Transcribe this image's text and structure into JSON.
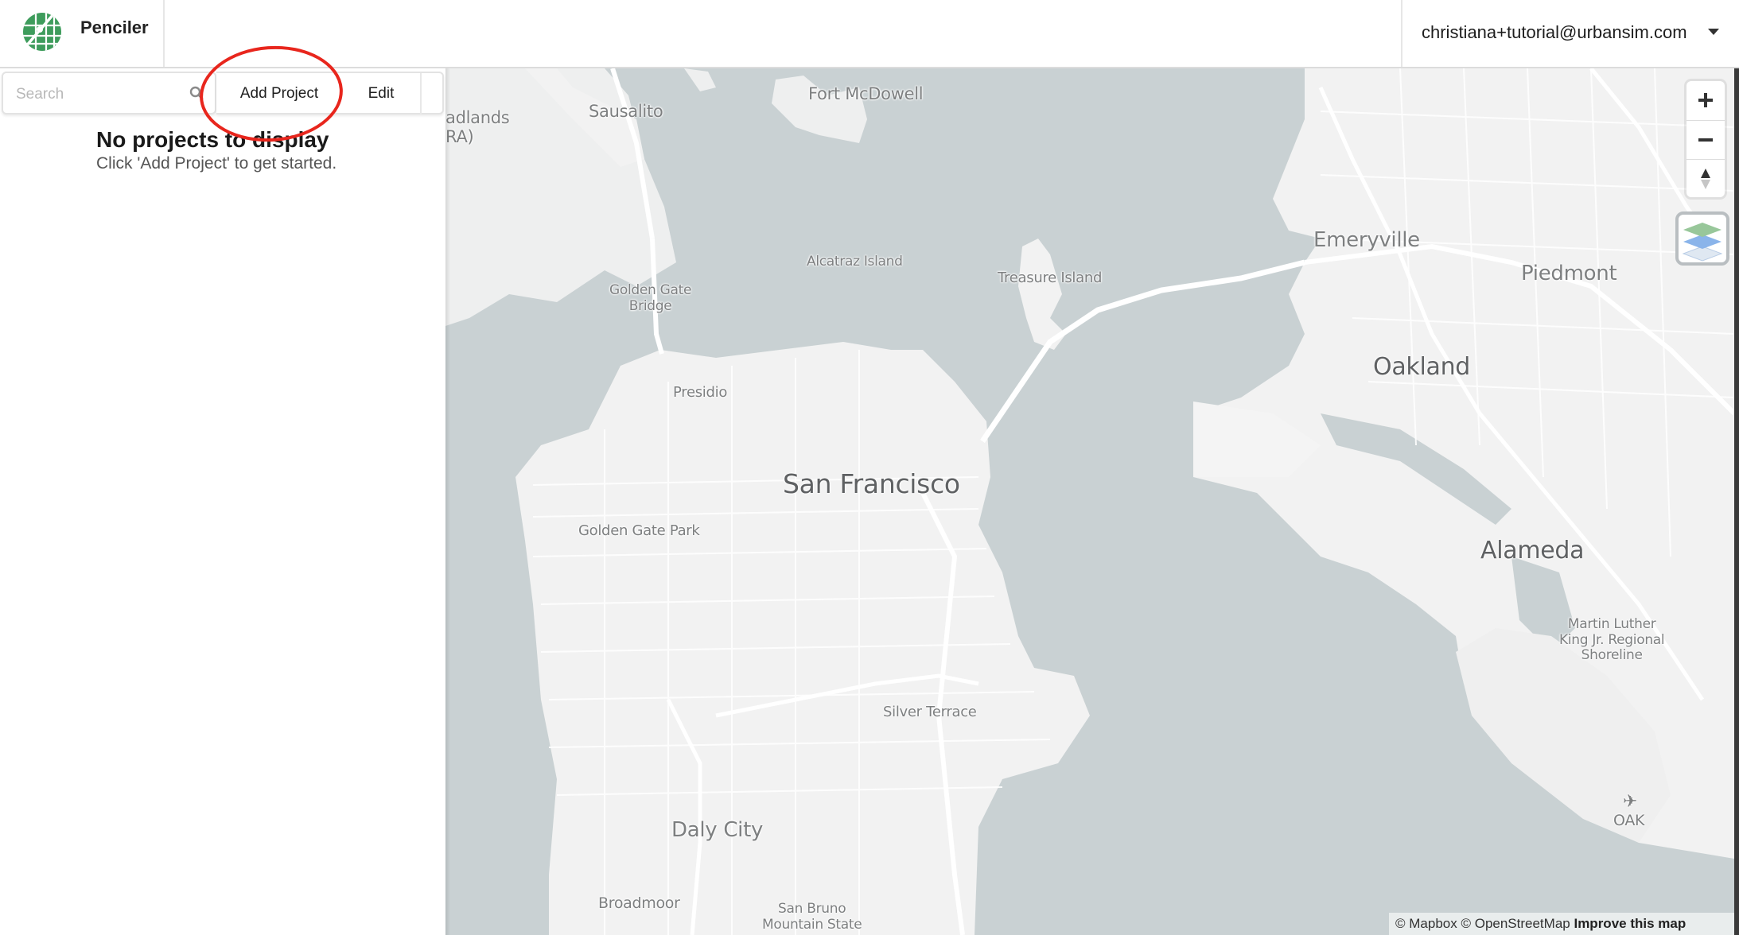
{
  "app": {
    "title": "Penciler",
    "user_email": "christiana+tutorial@urbansim.com"
  },
  "toolbar": {
    "search_placeholder": "Search",
    "search_value": "",
    "add_project_label": "Add Project",
    "edit_label": "Edit"
  },
  "empty_state": {
    "title": "No projects to display",
    "subtitle": "Click 'Add Project' to get started."
  },
  "map": {
    "labels": {
      "headlands": "adlands\nRA)",
      "sausalito": "Sausalito",
      "fort_mcdowell": "Fort McDowell",
      "alcatraz": "Alcatraz Island",
      "golden_gate_bridge": "Golden Gate\nBridge",
      "treasure_island": "Treasure Island",
      "emeryville": "Emeryville",
      "piedmont": "Piedmont",
      "oakland": "Oakland",
      "presidio": "Presidio",
      "san_francisco": "San Francisco",
      "golden_gate_park": "Golden Gate Park",
      "alameda": "Alameda",
      "mlk_shoreline": "Martin Luther\nKing Jr. Regional\nShoreline",
      "silver_terrace": "Silver Terrace",
      "daly_city": "Daly City",
      "oak": "OAK",
      "broadmoor": "Broadmoor",
      "san_bruno": "San Bruno\nMountain State"
    },
    "controls": {
      "zoom_in": "+",
      "zoom_out": "−"
    },
    "attribution": {
      "mapbox": "© Mapbox",
      "osm": "© OpenStreetMap",
      "improve": "Improve this map"
    },
    "colors": {
      "water": "#c9d1d3",
      "land": "#f2f2f2",
      "road": "#ffffff"
    }
  },
  "annotation": {
    "color": "#e8261d",
    "target": "Add Project"
  },
  "brand": {
    "logo_color": "#3e9c5c"
  }
}
